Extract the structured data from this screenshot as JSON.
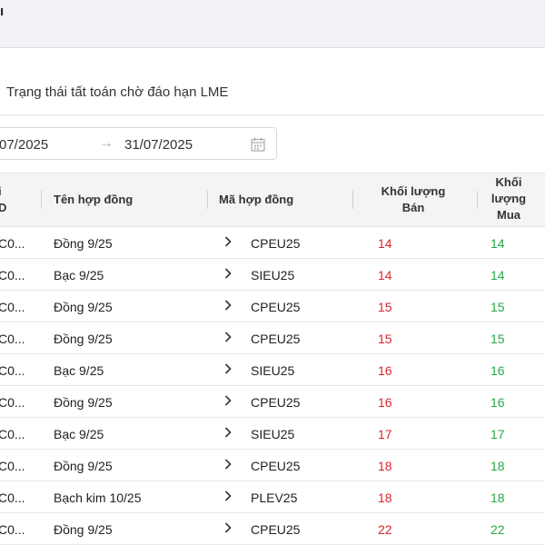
{
  "header": {
    "title": "ı"
  },
  "tab": {
    "label": "Trạng thái tất toán chờ đáo hạn LME"
  },
  "date_range": {
    "start": "07/2025",
    "separator": "→",
    "end": "31/07/2025",
    "icon": "calendar-icon"
  },
  "table": {
    "columns": {
      "id_line1": "i",
      "id_line2": "D",
      "name": "Tên hợp đồng",
      "code": "Mã hợp đồng",
      "sell_line1": "Khối lượng",
      "sell_line2": "Bán",
      "buy_line1": "Khối",
      "buy_line2": "lượng",
      "buy_line3": "Mua"
    },
    "rows": [
      {
        "id": "C0...",
        "name": "Đồng 9/25",
        "code": "CPEU25",
        "sell": "14",
        "buy": "14"
      },
      {
        "id": "C0...",
        "name": "Bạc 9/25",
        "code": "SIEU25",
        "sell": "14",
        "buy": "14"
      },
      {
        "id": "C0...",
        "name": "Đồng 9/25",
        "code": "CPEU25",
        "sell": "15",
        "buy": "15"
      },
      {
        "id": "C0...",
        "name": "Đồng 9/25",
        "code": "CPEU25",
        "sell": "15",
        "buy": "15"
      },
      {
        "id": "C0...",
        "name": "Bạc 9/25",
        "code": "SIEU25",
        "sell": "16",
        "buy": "16"
      },
      {
        "id": "C0...",
        "name": "Đồng 9/25",
        "code": "CPEU25",
        "sell": "16",
        "buy": "16"
      },
      {
        "id": "C0...",
        "name": "Bạc 9/25",
        "code": "SIEU25",
        "sell": "17",
        "buy": "17"
      },
      {
        "id": "C0...",
        "name": "Đồng 9/25",
        "code": "CPEU25",
        "sell": "18",
        "buy": "18"
      },
      {
        "id": "C0...",
        "name": "Bạch kim 10/25",
        "code": "PLEV25",
        "sell": "18",
        "buy": "18"
      },
      {
        "id": "C0...",
        "name": "Đồng 9/25",
        "code": "CPEU25",
        "sell": "22",
        "buy": "22"
      }
    ]
  },
  "colors": {
    "sell": "#d9262c",
    "buy": "#27a844",
    "header_bg": "#f1f2f7"
  }
}
